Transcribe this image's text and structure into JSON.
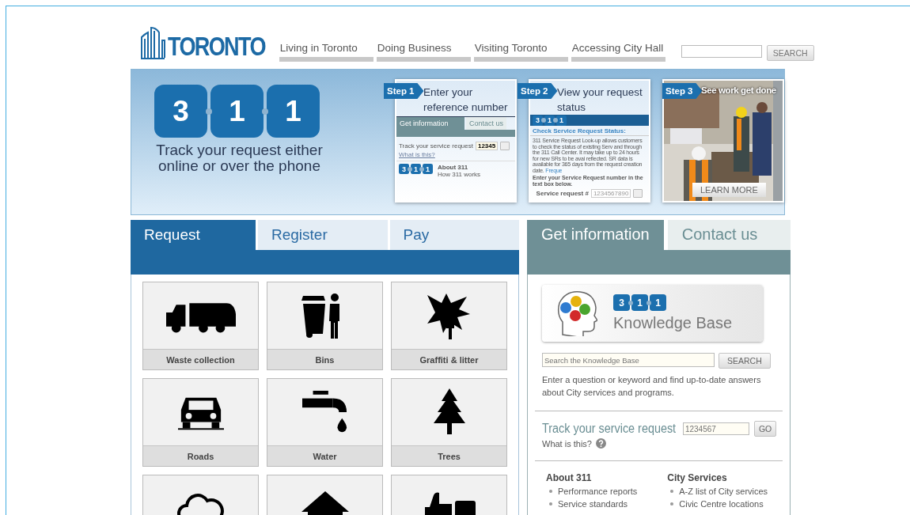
{
  "header": {
    "logo": "TORONTO",
    "nav": [
      {
        "label": "Living in Toronto"
      },
      {
        "label": "Doing Business"
      },
      {
        "label": "Visiting Toronto"
      },
      {
        "label": "Accessing City Hall"
      }
    ],
    "search": {
      "button": "SEARCH"
    }
  },
  "banner": {
    "digits": [
      "3",
      "1",
      "1"
    ],
    "tagline": "Track your request either online or over the phone",
    "steps": [
      {
        "kind": "lookup",
        "badge": "Step 1",
        "title": "Enter your reference number",
        "tabs": [
          "Get information",
          "Contact us"
        ],
        "track_label": "Track your service request",
        "track_value": "12345",
        "help": "What is this?",
        "digits": [
          "3",
          "1",
          "1"
        ],
        "about": "About 311",
        "about_item": "How 311 works"
      },
      {
        "kind": "status",
        "badge": "Step 2",
        "title": "View your request status",
        "digits": [
          "3",
          "1",
          "1"
        ],
        "heading": "Check Service Request Status:",
        "text": "311 Service Request Look-up allows customers to check the status of existing Serv and through the 311 Call Center. It may take up to 24 hours for new SRs to be avai reflected. SR data is available for 365 days from the request creation date.",
        "link": "Freque",
        "instruction": "Enter your Service Request number in the text box below.",
        "field_label": "Service request #",
        "field_placeholder": "1234567890"
      },
      {
        "badge": "Step 3",
        "title": "See work get done",
        "button": "LEARN MORE"
      }
    ]
  },
  "request_panel": {
    "tabs": [
      {
        "label": "Request",
        "selected": true
      },
      {
        "label": "Register",
        "selected": false
      },
      {
        "label": "Pay",
        "selected": false
      }
    ],
    "tiles": [
      {
        "label": "Waste collection"
      },
      {
        "label": "Bins"
      },
      {
        "label": "Graffiti & litter"
      },
      {
        "label": "Roads"
      },
      {
        "label": "Water"
      },
      {
        "label": "Trees"
      },
      {
        "kind": "cut"
      },
      {
        "kind": "cut"
      },
      {
        "kind": "cut"
      }
    ]
  },
  "info_panel": {
    "tabs": [
      {
        "label": "Get information",
        "selected": true
      },
      {
        "label": "Contact us",
        "selected": false
      }
    ],
    "knowledge_base": {
      "digits": [
        "3",
        "1",
        "1"
      ],
      "title": "Knowledge Base",
      "placeholder": "Search the Knowledge Base",
      "button": "SEARCH",
      "description": "Enter a question or keyword and find up-to-date answers about City services and programs."
    },
    "track": {
      "title": "Track your service request",
      "placeholder": "1234567",
      "button": "GO",
      "help": "What is this?"
    },
    "lists": [
      {
        "heading": "About 311",
        "items": [
          "Performance reports",
          "Service standards"
        ]
      },
      {
        "heading": "City Services",
        "items": [
          "A-Z list of City services",
          "Civic Centre locations"
        ]
      }
    ]
  }
}
